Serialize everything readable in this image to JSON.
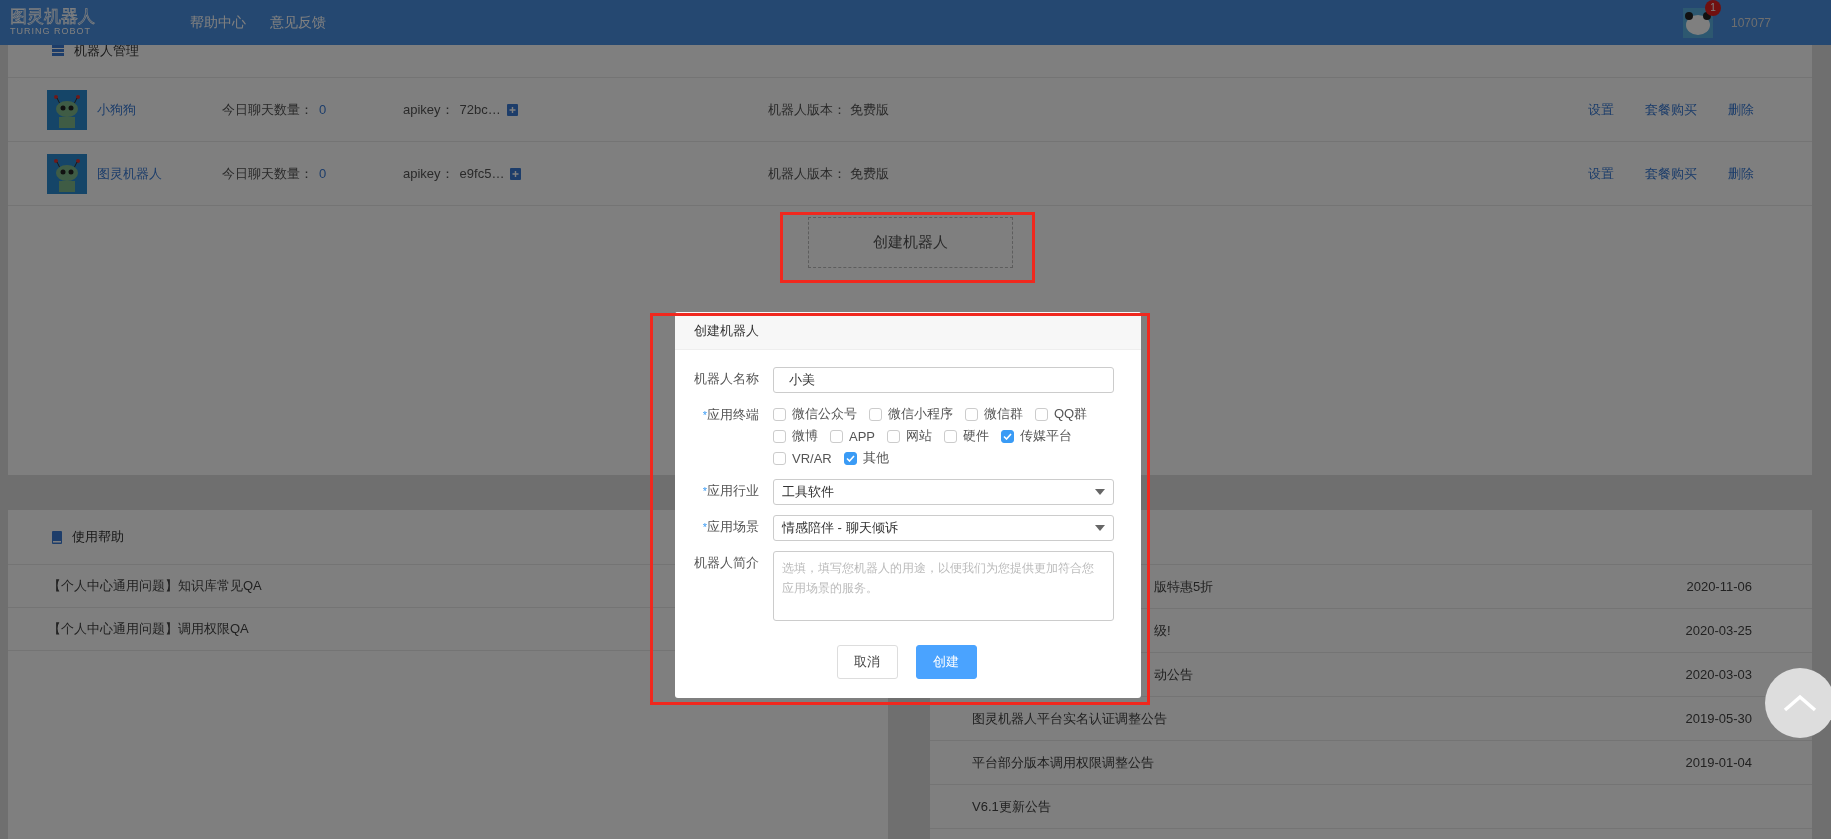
{
  "top_bar": {
    "logo": {
      "title": "图灵机器人",
      "subtitle": "TURING ROBOT"
    },
    "nav": [
      {
        "label": "帮助中心"
      },
      {
        "label": "意见反馈"
      }
    ],
    "user": {
      "badge": "1",
      "name": "107077"
    }
  },
  "robot_panel": {
    "title": "机器人管理",
    "robots": [
      {
        "name": "小狗狗",
        "chat_label": "今日聊天数量：",
        "chat_count": "0",
        "apikey_label": "apikey：",
        "apikey": "72bc…",
        "version_label": "机器人版本：",
        "version": "免费版",
        "actions": [
          "设置",
          "套餐购买",
          "删除"
        ]
      },
      {
        "name": "图灵机器人",
        "chat_label": "今日聊天数量：",
        "chat_count": "0",
        "apikey_label": "apikey：",
        "apikey": "e9fc5…",
        "version_label": "机器人版本：",
        "version": "免费版",
        "actions": [
          "设置",
          "套餐购买",
          "删除"
        ]
      }
    ],
    "create_button": "创建机器人"
  },
  "help_panel": {
    "title": "使用帮助",
    "items": [
      "【个人中心通用问题】知识库常见QA",
      "【个人中心通用问题】调用权限QA"
    ]
  },
  "news_panel": {
    "items": [
      {
        "title": "版特惠5折",
        "date": "2020-11-06",
        "covered": true
      },
      {
        "title": "级!",
        "date": "2020-03-25",
        "covered": true
      },
      {
        "title": "动公告",
        "date": "2020-03-03",
        "covered": true
      },
      {
        "title": "图灵机器人平台实名认证调整公告",
        "date": "2019-05-30",
        "covered": false
      },
      {
        "title": "平台部分版本调用权限调整公告",
        "date": "2019-01-04",
        "covered": false
      },
      {
        "title": "V6.1更新公告",
        "covered": false
      }
    ]
  },
  "dialog": {
    "title": "创建机器人",
    "fields": [
      {
        "kind": "input",
        "label": "机器人名称",
        "value": "小美"
      },
      {
        "kind": "checkboxes",
        "label": "应用终端",
        "mark": "*",
        "options": [
          {
            "label": "微信公众号",
            "checked": false
          },
          {
            "label": "微信小程序",
            "checked": false
          },
          {
            "label": "微信群",
            "checked": false
          },
          {
            "label": "QQ群",
            "checked": false
          },
          {
            "label": "微博",
            "checked": false
          },
          {
            "label": "APP",
            "checked": false
          },
          {
            "label": "网站",
            "checked": false
          },
          {
            "label": "硬件",
            "checked": false
          },
          {
            "label": "传媒平台",
            "checked": true
          },
          {
            "label": "VR/AR",
            "checked": false
          },
          {
            "label": "其他",
            "checked": true
          }
        ]
      },
      {
        "kind": "select",
        "label": "应用行业",
        "mark": "*",
        "value": "工具软件"
      },
      {
        "kind": "select",
        "label": "应用场景",
        "mark": "*",
        "value": "情感陪伴 - 聊天倾诉"
      },
      {
        "kind": "textarea",
        "label": "机器人简介",
        "placeholder": "选填，填写您机器人的用途，以便我们为您提供更加符合您应用场景的服务。"
      }
    ],
    "buttons": [
      {
        "label": "取消",
        "primary": false
      },
      {
        "label": "创建",
        "primary": true
      }
    ]
  }
}
